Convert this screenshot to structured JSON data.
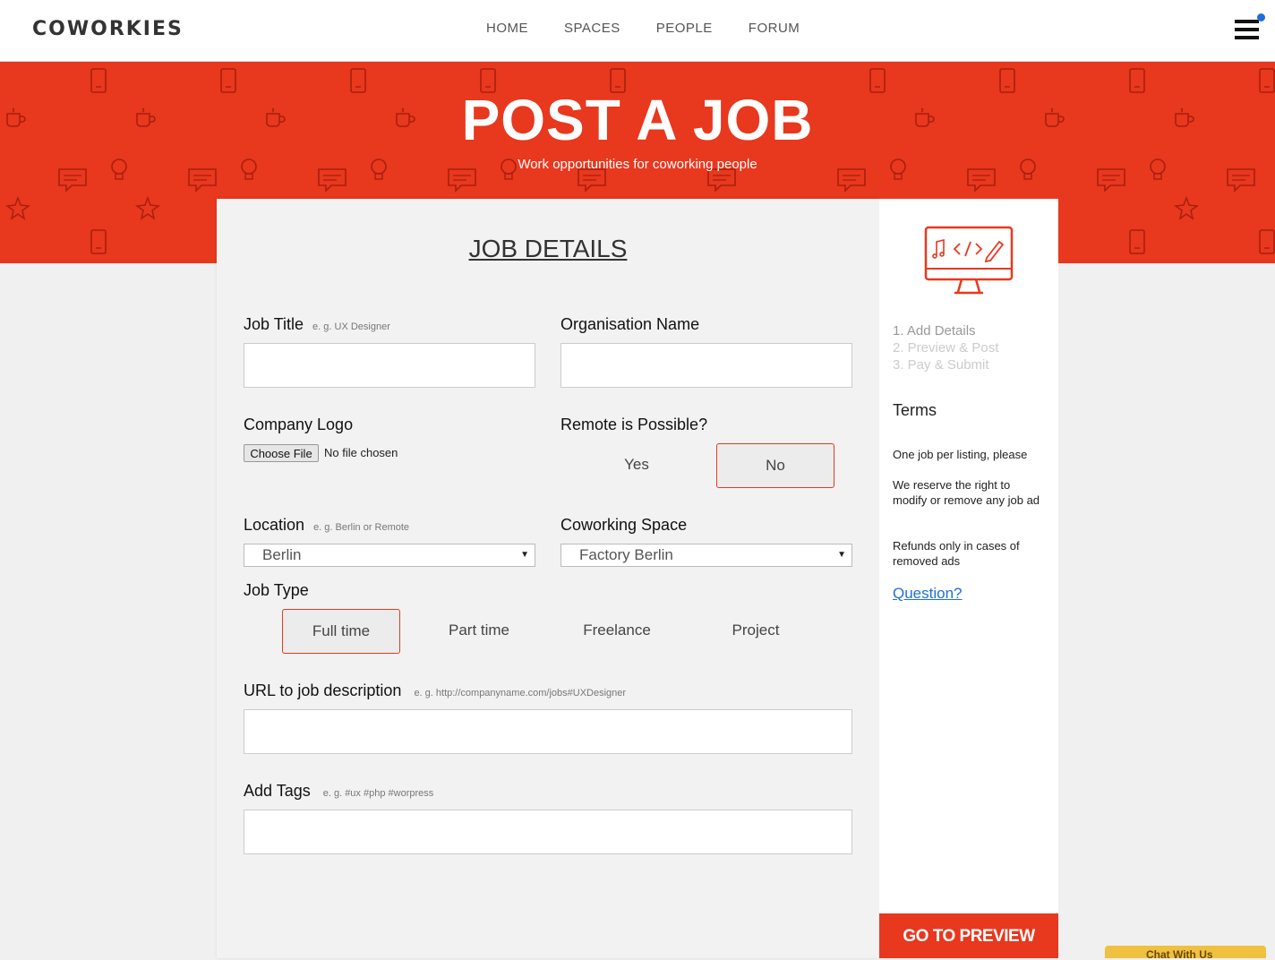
{
  "brand": {
    "logo": "COWORKIES"
  },
  "nav": {
    "items": [
      "HOME",
      "SPACES",
      "PEOPLE",
      "FORUM"
    ]
  },
  "hero": {
    "title": "POST A JOB",
    "subtitle": "Work opportunities for coworking people"
  },
  "form": {
    "section_title": "JOB DETAILS",
    "job_title": {
      "label": "Job Title",
      "hint": "e. g. UX Designer",
      "value": ""
    },
    "organisation": {
      "label": "Organisation Name",
      "value": ""
    },
    "logo": {
      "label": "Company Logo",
      "button": "Choose File",
      "status": "No file chosen"
    },
    "remote": {
      "label": "Remote is Possible?",
      "options": [
        "Yes",
        "No"
      ],
      "selected": "No"
    },
    "location": {
      "label": "Location",
      "hint": "e. g. Berlin or Remote",
      "value": "Berlin"
    },
    "coworking": {
      "label": "Coworking Space",
      "value": "Factory Berlin"
    },
    "job_type": {
      "label": "Job Type",
      "options": [
        "Full time",
        "Part time",
        "Freelance",
        "Project"
      ],
      "selected": "Full time"
    },
    "url": {
      "label": "URL to job description",
      "hint": "e. g. http://companyname.com/jobs#UXDesigner",
      "value": ""
    },
    "tags": {
      "label": "Add Tags",
      "hint": "e. g. #ux #php #worpress",
      "value": ""
    }
  },
  "sidebar": {
    "steps": [
      "1. Add Details",
      "2. Preview & Post",
      "3. Pay & Submit"
    ],
    "terms_title": "Terms",
    "terms": [
      "One job per listing, please",
      "We reserve the right to modify or remove any job ad",
      "Refunds only in cases of removed ads"
    ],
    "question_link": "Question?",
    "preview_button": "GO TO PREVIEW"
  },
  "chat": {
    "label": "Chat With Us"
  },
  "colors": {
    "accent": "#e8381e",
    "link": "#1e6fd9",
    "background": "#f0f0f0"
  }
}
